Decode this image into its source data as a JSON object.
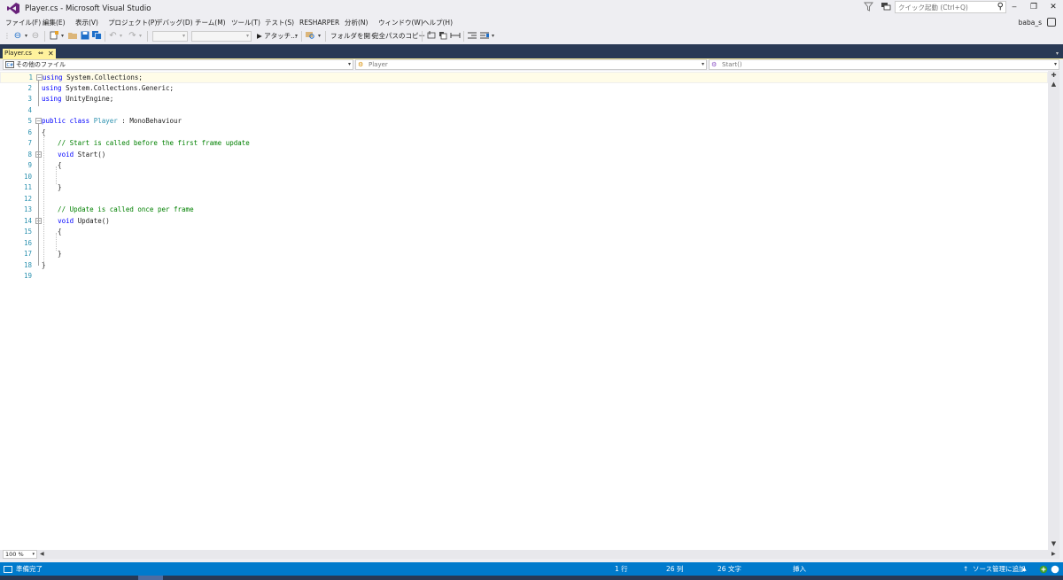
{
  "window": {
    "title": "Player.cs - Microsoft Visual Studio",
    "quick_launch_placeholder": "クイック起動 (Ctrl+Q)",
    "user": "baba_s",
    "min": "‒",
    "max": "❐",
    "close": "✕"
  },
  "menu": [
    "ファイル(F)",
    "編集(E)",
    "表示(V)",
    "プロジェクト(P)",
    "デバッグ(D)",
    "チーム(M)",
    "ツール(T)",
    "テスト(S)",
    "RESHARPER",
    "分析(N)",
    "ウィンドウ(W)",
    "ヘルプ(H)"
  ],
  "toolbar": {
    "attach_label": "▶ アタッチ...",
    "open_folder": "フォルダを開く",
    "copy_path": "完全パスのコピー"
  },
  "tab": {
    "label": "Player.cs",
    "pin": "⇔",
    "close": "✕"
  },
  "navbar": {
    "project": "その他のファイル",
    "type": "Player",
    "member": "Start()"
  },
  "code": {
    "line_numbers": [
      "1",
      "2",
      "3",
      "4",
      "5",
      "6",
      "7",
      "8",
      "9",
      "10",
      "11",
      "12",
      "13",
      "14",
      "15",
      "16",
      "17",
      "18",
      "19"
    ],
    "lines": [
      {
        "k": "using",
        "t": " System.Collections;"
      },
      {
        "k": "using",
        "t": " System.Collections.Generic;"
      },
      {
        "k": "using",
        "t": " UnityEngine;"
      },
      {
        "t": ""
      },
      {
        "k": "public class",
        "c": " Player",
        "t": " : MonoBehaviour"
      },
      {
        "t": "{"
      },
      {
        "cm": "    // Start is called before the first frame update"
      },
      {
        "pre": "    ",
        "k": "void",
        "t": " Start()"
      },
      {
        "t": "    {"
      },
      {
        "t": ""
      },
      {
        "t": "    }"
      },
      {
        "t": ""
      },
      {
        "cm": "    // Update is called once per frame"
      },
      {
        "pre": "    ",
        "k": "void",
        "t": " Update()"
      },
      {
        "t": "    {"
      },
      {
        "t": ""
      },
      {
        "t": "    }"
      },
      {
        "t": "}"
      },
      {
        "t": ""
      }
    ]
  },
  "zoom": "100 %",
  "status": {
    "ready": "準備完了",
    "line": "1 行",
    "col": "26 列",
    "ch": "26 文字",
    "mode": "挿入",
    "source_control": "ソース管理に追加"
  }
}
